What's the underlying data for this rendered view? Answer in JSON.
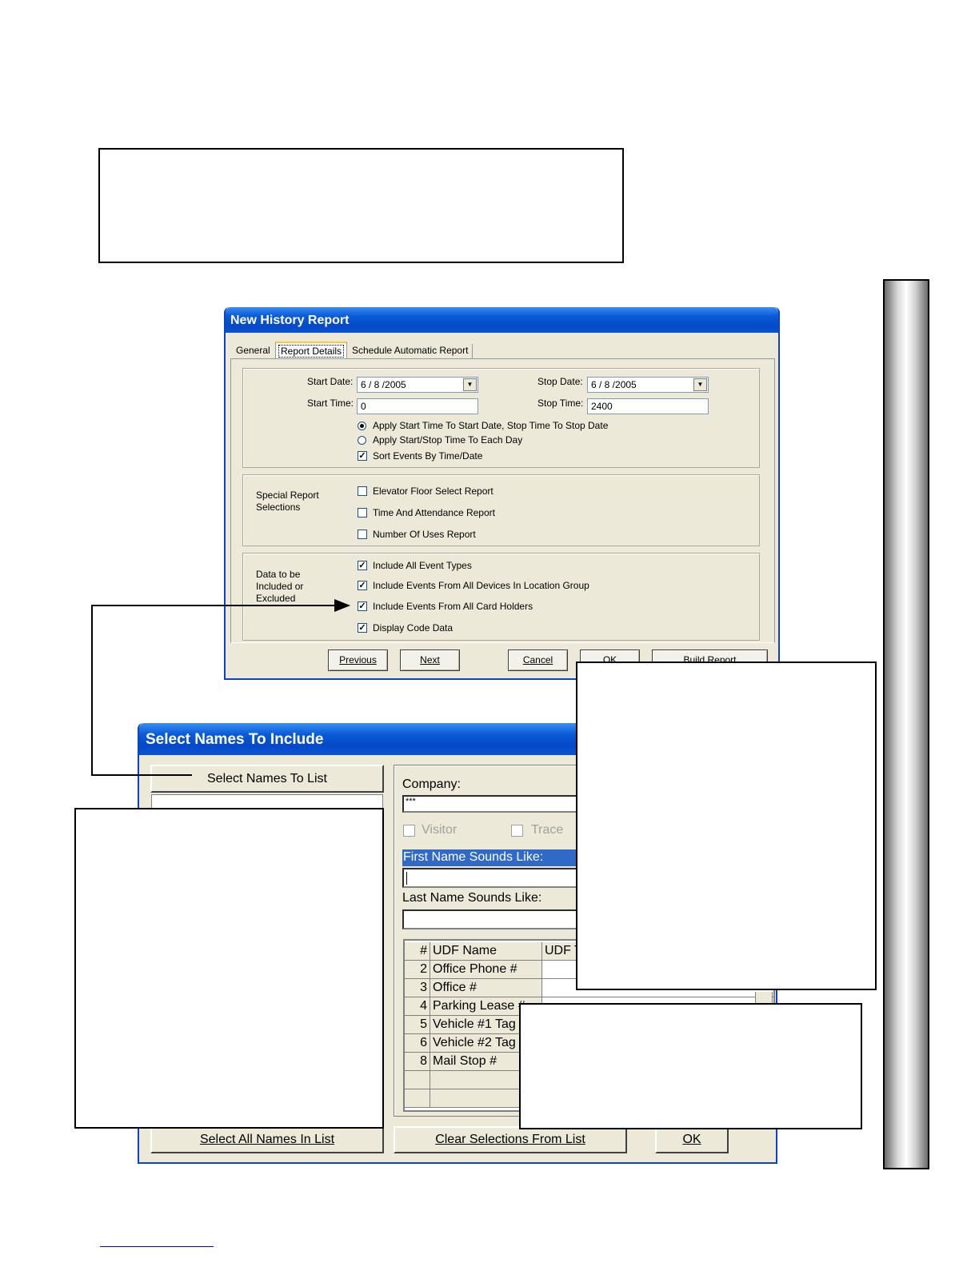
{
  "history_report": {
    "title": "New History Report",
    "tabs": [
      "General",
      "Report Details",
      "Schedule Automatic Report"
    ],
    "start_date_label": "Start Date:",
    "start_date_value": "6 / 8 /2005",
    "stop_date_label": "Stop Date:",
    "stop_date_value": "6 / 8 /2005",
    "start_time_label": "Start Time:",
    "start_time_value": "0",
    "stop_time_label": "Stop Time:",
    "stop_time_value": "2400",
    "options": [
      {
        "label": "Apply Start Time To Start Date, Stop Time To Stop Date",
        "type": "radio",
        "checked": true
      },
      {
        "label": "Apply Start/Stop Time To Each Day",
        "type": "radio",
        "checked": false
      },
      {
        "label": "Sort Events By Time/Date",
        "type": "checkbox",
        "checked": true
      }
    ],
    "special_label": "Special Report Selections",
    "special": [
      {
        "label": "Elevator Floor Select Report",
        "checked": false
      },
      {
        "label": "Time And Attendance Report",
        "checked": false
      },
      {
        "label": "Number Of Uses Report",
        "checked": false
      }
    ],
    "data_label": "Data to be Included or Excluded",
    "data_options": [
      {
        "label": "Include All Event Types",
        "checked": true
      },
      {
        "label": "Include Events From All Devices In Location Group",
        "checked": true
      },
      {
        "label": "Include Events From All Card Holders",
        "checked": true
      },
      {
        "label": "Display Code Data",
        "checked": true
      }
    ],
    "buttons": {
      "previous": "Previous",
      "next": "Next",
      "cancel": "Cancel",
      "ok": "OK",
      "build": "Build Report"
    }
  },
  "select_names": {
    "title": "Select Names To Include",
    "select_names_button": "Select Names To List",
    "company_label": "Company:",
    "company_value": "***",
    "visitor_label": "Visitor",
    "trace_label": "Trace",
    "first_name_label": "First Name Sounds Like:",
    "last_name_label": "Last Name Sounds Like:",
    "grid_headers": {
      "num": "#",
      "name": "UDF Name",
      "udf": "UDF T"
    },
    "grid_rows": [
      {
        "num": "2",
        "name": "Office Phone #"
      },
      {
        "num": "3",
        "name": "Office #"
      },
      {
        "num": "4",
        "name": "Parking Lease #"
      },
      {
        "num": "5",
        "name": "Vehicle #1 Tag"
      },
      {
        "num": "6",
        "name": "Vehicle #2 Tag"
      },
      {
        "num": "8",
        "name": "Mail Stop #"
      },
      {
        "num": "",
        "name": ""
      },
      {
        "num": "",
        "name": ""
      }
    ],
    "select_all_button": "Select All Names In List",
    "clear_button": "Clear Selections From List",
    "ok_button": "OK"
  }
}
